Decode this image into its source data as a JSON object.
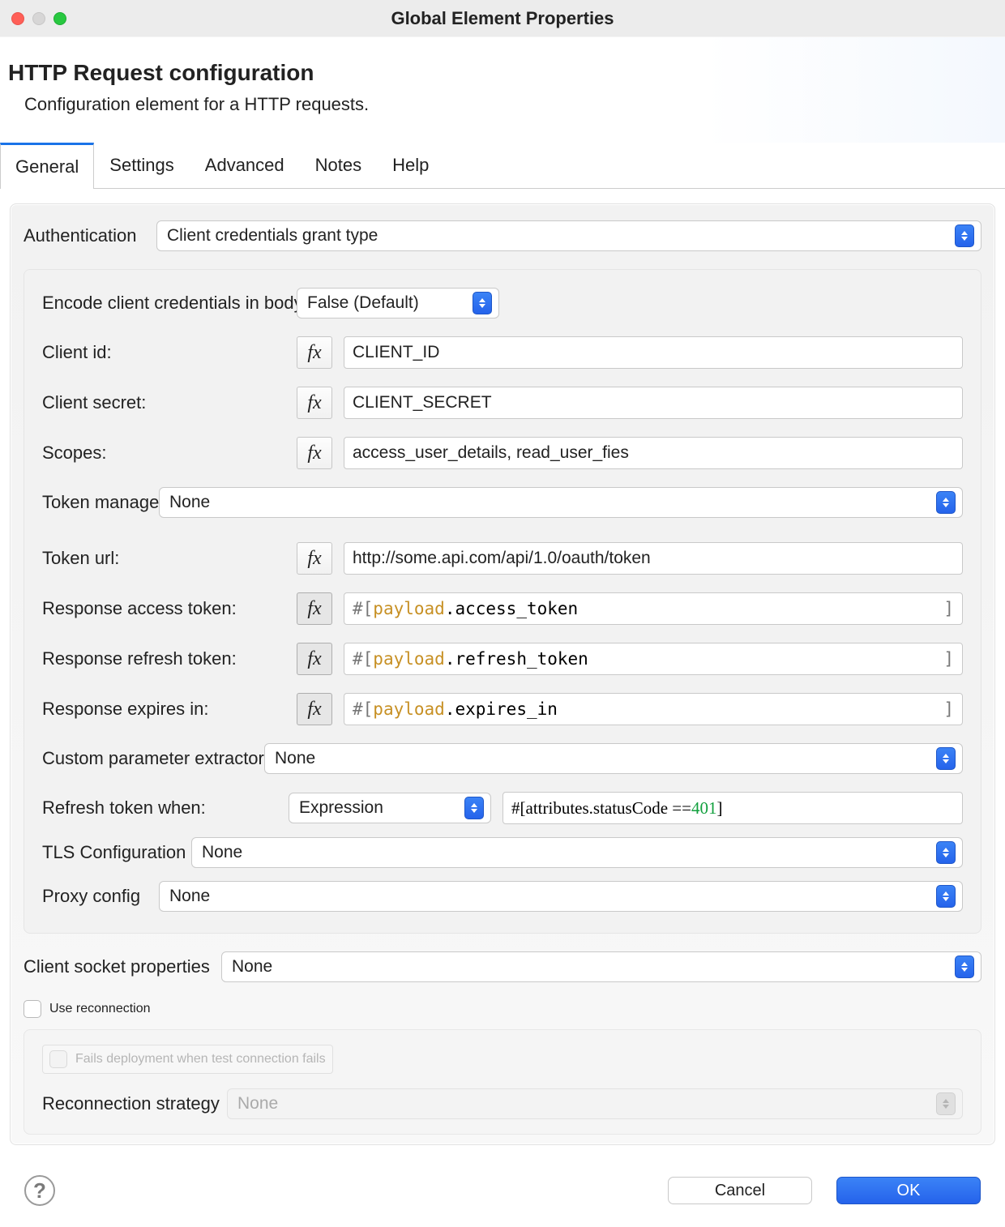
{
  "window": {
    "title": "Global Element Properties"
  },
  "header": {
    "title": "HTTP Request configuration",
    "desc": "Configuration element for a HTTP requests."
  },
  "tabs": [
    "General",
    "Settings",
    "Advanced",
    "Notes",
    "Help"
  ],
  "activeTab": 0,
  "labels": {
    "authentication": "Authentication",
    "encode": "Encode client credentials in body:",
    "client_id": "Client id:",
    "client_secret": "Client secret:",
    "scopes": "Scopes:",
    "token_mgr": "Token manager",
    "token_url": "Token url:",
    "resp_at": "Response access token:",
    "resp_rt": "Response refresh token:",
    "resp_ei": "Response expires in:",
    "cpe": "Custom parameter extractors",
    "rtw": "Refresh token when:",
    "tls": "TLS Configuration",
    "proxy": "Proxy config",
    "csp": "Client socket properties",
    "use_reconn": "Use reconnection",
    "fails": "Fails deployment when test connection fails",
    "recon_strategy": "Reconnection strategy"
  },
  "selects": {
    "authentication": "Client credentials grant type",
    "encode": "False (Default)",
    "token_mgr": "None",
    "cpe": "None",
    "rtw_mode": "Expression",
    "tls": "None",
    "proxy": "None",
    "csp": "None",
    "recon_strategy": "None"
  },
  "fields": {
    "client_id": "CLIENT_ID",
    "client_secret": "CLIENT_SECRET",
    "scopes": "access_user_details, read_user_fies",
    "token_url": "http://some.api.com/api/1.0/oauth/token"
  },
  "expr": {
    "prefix": "#[ ",
    "suffix": " ]",
    "kw": "payload",
    "at": ".access_token",
    "rt": ".refresh_token",
    "ei": ".expires_in",
    "rtw_pre": "#[",
    "rtw_body": "attributes.statusCode == ",
    "rtw_num": "401",
    "rtw_suf": " ]"
  },
  "fx": "fx",
  "footer": {
    "help": "?",
    "cancel": "Cancel",
    "ok": "OK"
  }
}
